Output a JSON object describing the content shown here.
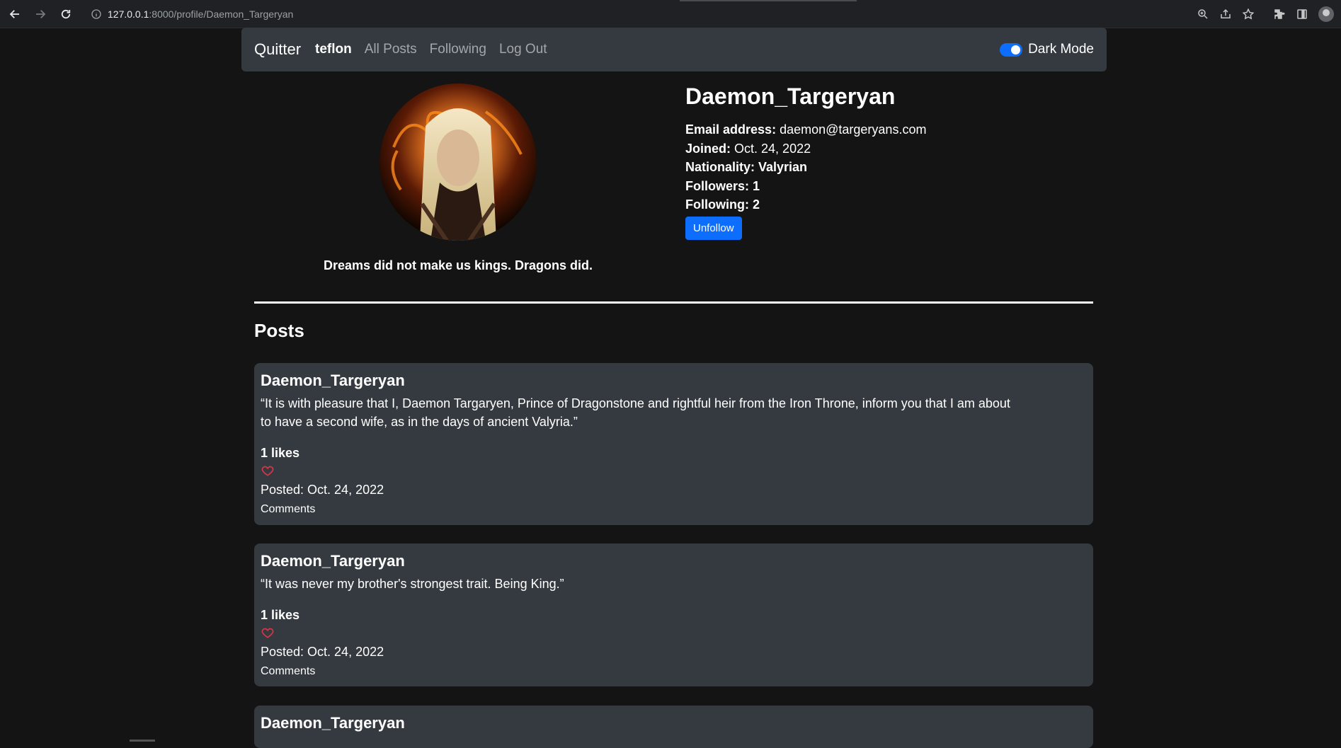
{
  "browser": {
    "url_host": "127.0.0.1",
    "url_path": ":8000/profile/Daemon_Targeryan"
  },
  "navbar": {
    "brand": "Quitter",
    "user": "teflon",
    "links": [
      "All Posts",
      "Following",
      "Log Out"
    ],
    "dark_mode_label": "Dark Mode",
    "dark_mode_on": true
  },
  "profile": {
    "username": "Daemon_Targeryan",
    "email_label": "Email address:",
    "email": "daemon@targeryans.com",
    "joined_label": "Joined:",
    "joined": "Oct. 24, 2022",
    "nationality": "Nationality: Valyrian",
    "followers": "Followers: 1",
    "following": "Following: 2",
    "unfollow_label": "Unfollow",
    "bio": "Dreams did not make us kings. Dragons did."
  },
  "posts_heading": "Posts",
  "posts": [
    {
      "author": "Daemon_Targeryan",
      "content": "“It is with pleasure that I, Daemon Targaryen, Prince of Dragonstone and rightful heir from the Iron Throne, inform you that I am about to have a second wife, as in the days of ancient Valyria.”",
      "likes": "1 likes",
      "posted": "Posted: Oct. 24, 2022",
      "comments": "Comments"
    },
    {
      "author": "Daemon_Targeryan",
      "content": "“It was never my brother's strongest trait. Being King.”",
      "likes": "1 likes",
      "posted": "Posted: Oct. 24, 2022",
      "comments": "Comments"
    },
    {
      "author": "Daemon_Targeryan"
    }
  ],
  "colors": {
    "page_bg": "#141414",
    "card_bg": "#343a40",
    "accent": "#0d6efd",
    "heart": "#dc3545"
  }
}
